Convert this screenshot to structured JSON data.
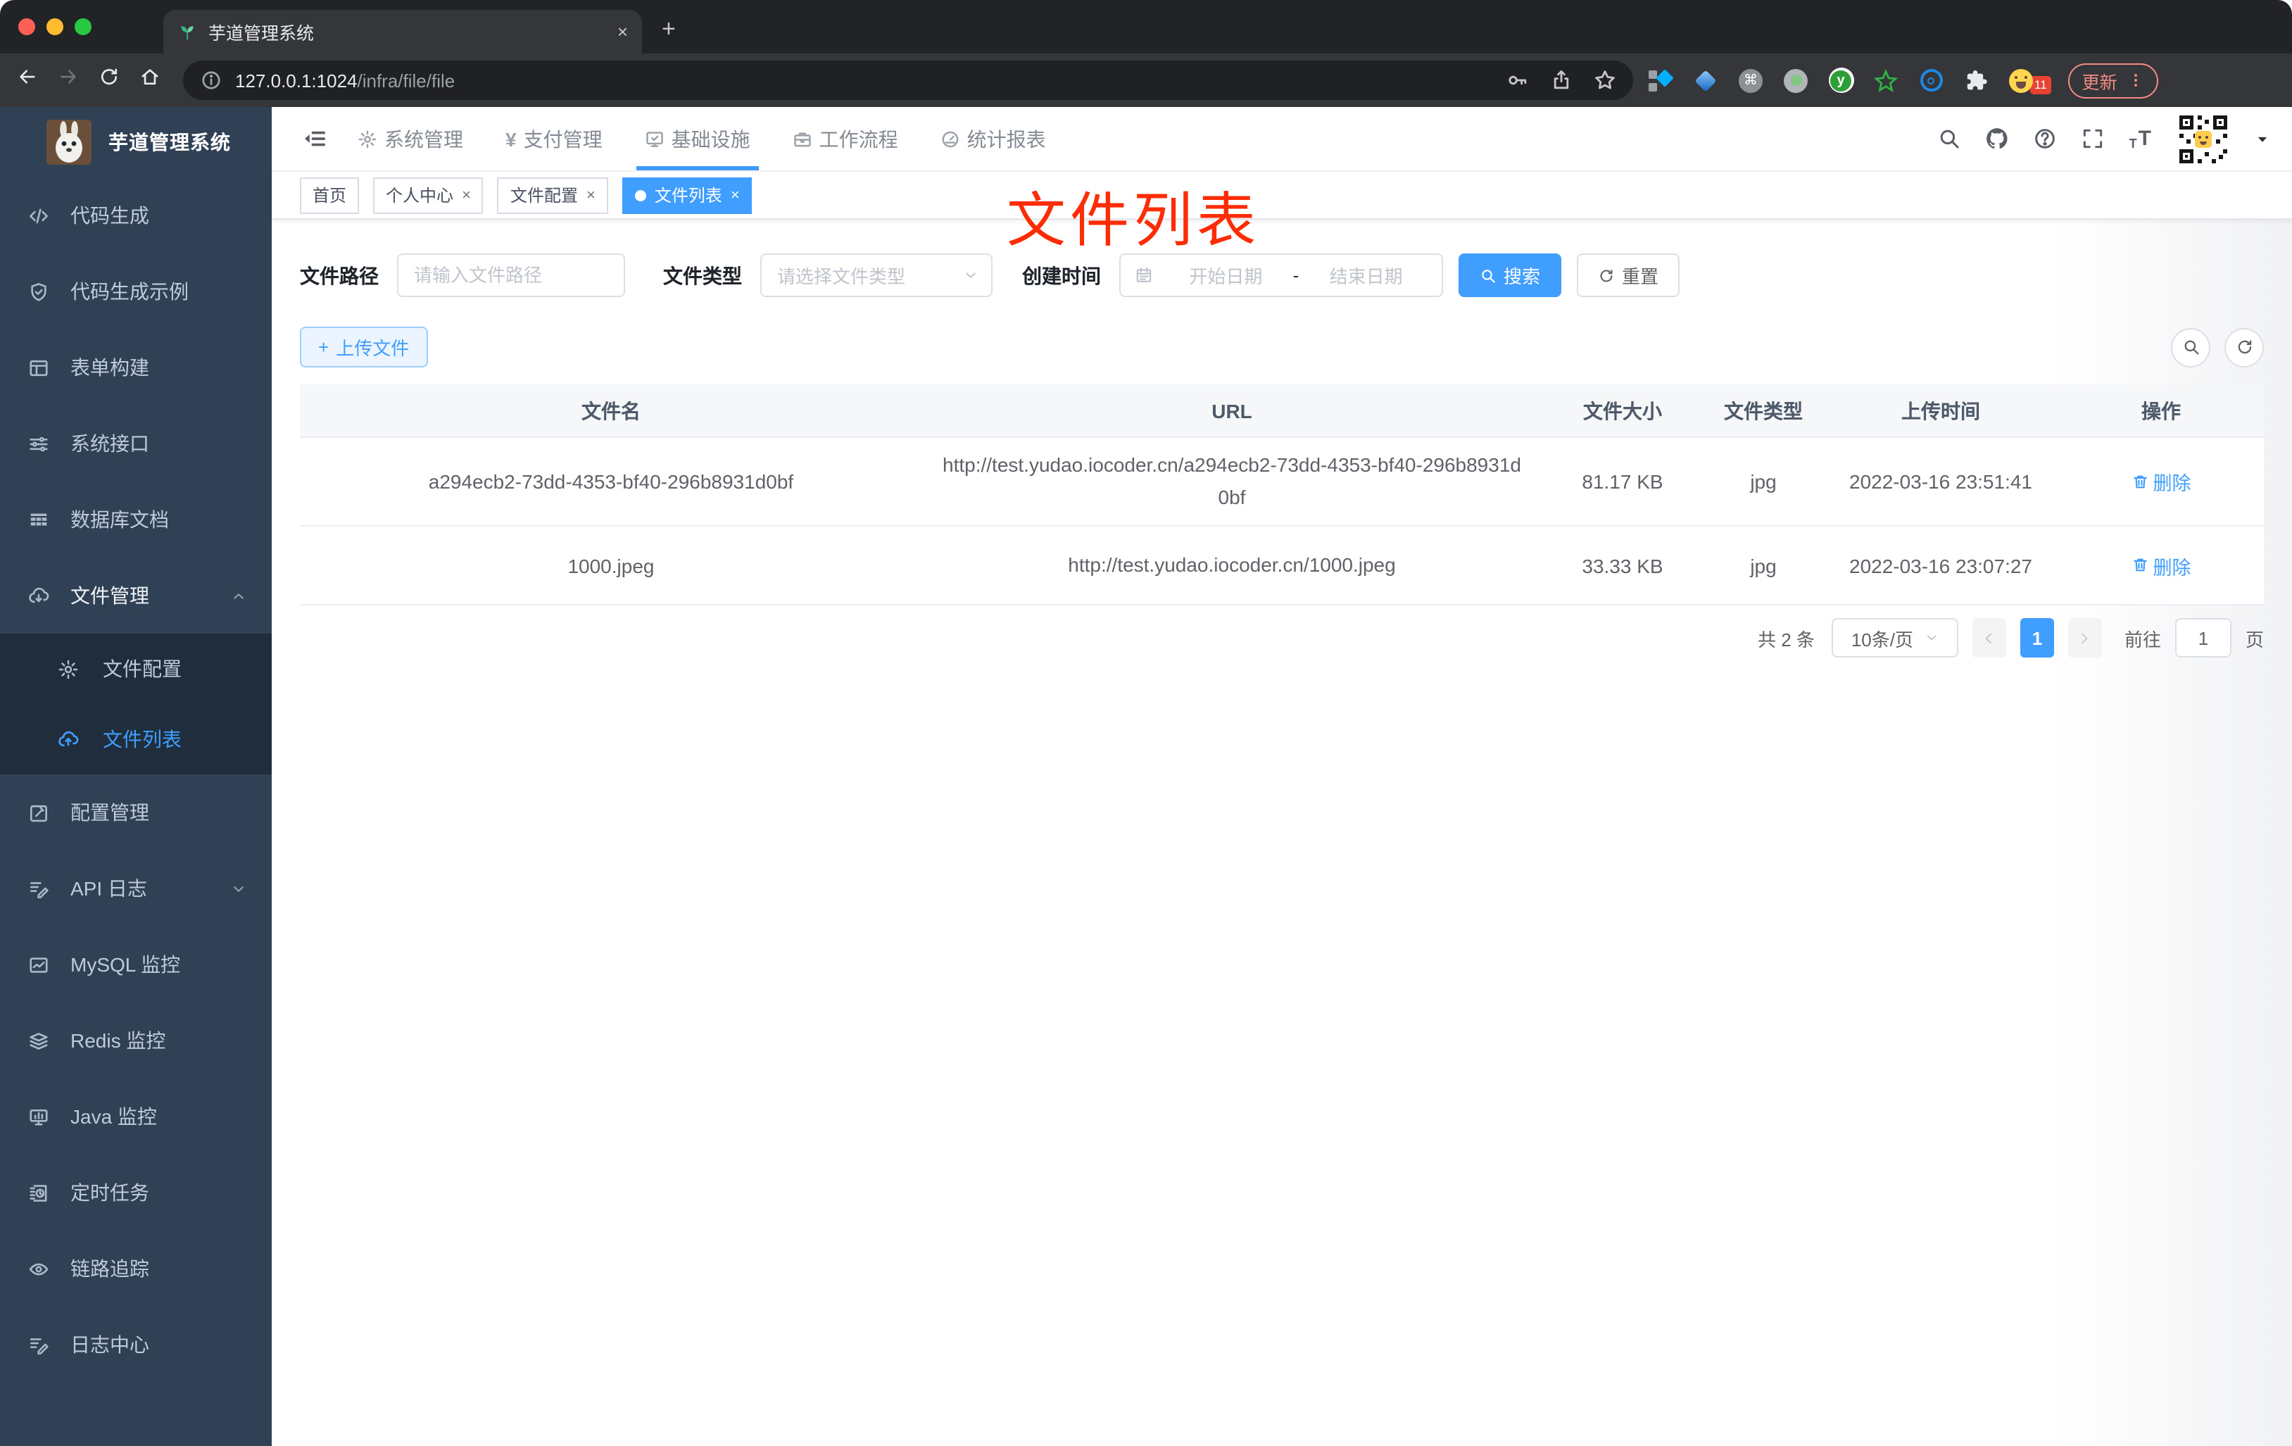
{
  "colors": {
    "accent": "#409eff",
    "sidebar_bg": "#304156",
    "submenu_bg": "#1f2d3d",
    "annotation_red": "#fb2c06",
    "update_chip": "#f28b82"
  },
  "browser": {
    "window_controls": [
      "close-light-icon",
      "minimize-light-icon",
      "maximize-light-icon"
    ],
    "tab": {
      "favicon": "leaf",
      "title": "芋道管理系统",
      "close_glyph": "×"
    },
    "new_tab_glyph": "+",
    "nav_icons": [
      {
        "icon": "back"
      },
      {
        "icon": "forward",
        "dim": true
      },
      {
        "icon": "reload"
      },
      {
        "icon": "home"
      }
    ],
    "url": {
      "info_icon": "info",
      "host": "127.0.0.1:1024",
      "path": "/infra/file/file"
    },
    "pill_actions": [
      "key",
      "share",
      "star"
    ],
    "extensions": [
      "ext-collector",
      "ext-gem",
      "ext-command",
      "ext-record",
      "ext-yudao",
      "ext-star",
      "ext-lens",
      "ext-puzzle",
      "ext-emoji"
    ],
    "extension_badge": "11",
    "update_label": "更新",
    "menu_icon": "dots-v"
  },
  "sidebar": {
    "logo_icon": "rabbit",
    "title": "芋道管理系统",
    "items": [
      {
        "label": "代码生成",
        "icon": "code"
      },
      {
        "label": "代码生成示例",
        "icon": "shield-check"
      },
      {
        "label": "表单构建",
        "icon": "form"
      },
      {
        "label": "系统接口",
        "icon": "sliders"
      },
      {
        "label": "数据库文档",
        "icon": "table"
      },
      {
        "label": "文件管理",
        "icon": "cloud-download",
        "chevron": "chevron-up",
        "open": true
      },
      {
        "label": "文件配置",
        "icon": "gear",
        "sub": true
      },
      {
        "label": "文件列表",
        "icon": "cloud-upload",
        "sub": true,
        "active": true
      },
      {
        "label": "配置管理",
        "icon": "edit"
      },
      {
        "label": "API 日志",
        "icon": "doc-edit",
        "chevron": "chevron-down"
      },
      {
        "label": "MySQL 监控",
        "icon": "chart"
      },
      {
        "label": "Redis 监控",
        "icon": "layers"
      },
      {
        "label": "Java 监控",
        "icon": "monitor-bars"
      },
      {
        "label": "定时任务",
        "icon": "timer"
      },
      {
        "label": "链路追踪",
        "icon": "eye"
      },
      {
        "label": "日志中心",
        "icon": "doc-edit"
      }
    ]
  },
  "topnav": {
    "collapse_icon": "hamburger",
    "menus": [
      {
        "label": "系统管理",
        "icon": "gear"
      },
      {
        "label": "支付管理",
        "icon": "yen"
      },
      {
        "label": "基础设施",
        "icon": "monitor-check",
        "active": true
      },
      {
        "label": "工作流程",
        "icon": "toolbox"
      },
      {
        "label": "统计报表",
        "icon": "gauge"
      }
    ],
    "right_icons": [
      "search",
      "github",
      "help",
      "fullscreen",
      "font-size"
    ],
    "avatar_icon": "qr-avatar",
    "caret_icon": "caret-down"
  },
  "tags": [
    {
      "label": "首页"
    },
    {
      "label": "个人中心",
      "closable": true
    },
    {
      "label": "文件配置",
      "closable": true
    },
    {
      "label": "文件列表",
      "closable": true,
      "active": true
    }
  ],
  "annotation": "文件列表",
  "filters": {
    "path_label": "文件路径",
    "path_placeholder": "请输入文件路径",
    "type_label": "文件类型",
    "type_placeholder": "请选择文件类型",
    "date_label": "创建时间",
    "date_start": "开始日期",
    "date_separator": "-",
    "date_end": "结束日期",
    "search_label": "搜索",
    "reset_label": "重置"
  },
  "toolbar": {
    "upload_label": "上传文件",
    "plus_glyph": "+"
  },
  "table": {
    "columns": [
      "文件名",
      "URL",
      "文件大小",
      "文件类型",
      "上传时间",
      "操作"
    ],
    "rows": [
      {
        "name": "a294ecb2-73dd-4353-bf40-296b8931d0bf",
        "url": "http://test.yudao.iocoder.cn/a294ecb2-73dd-4353-bf40-296b8931d0bf",
        "size": "81.17 KB",
        "type": "jpg",
        "time": "2022-03-16 23:51:41",
        "action": "删除",
        "tall": true
      },
      {
        "name": "1000.jpeg",
        "url": "http://test.yudao.iocoder.cn/1000.jpeg",
        "size": "33.33 KB",
        "type": "jpg",
        "time": "2022-03-16 23:07:27",
        "action": "删除"
      }
    ]
  },
  "pagination": {
    "total": "共 2 条",
    "page_size": "10条/页",
    "prev_icon": "chevron-left",
    "current": "1",
    "next_icon": "chevron-right",
    "goto_label": "前往",
    "goto_value": "1",
    "unit_label": "页"
  }
}
